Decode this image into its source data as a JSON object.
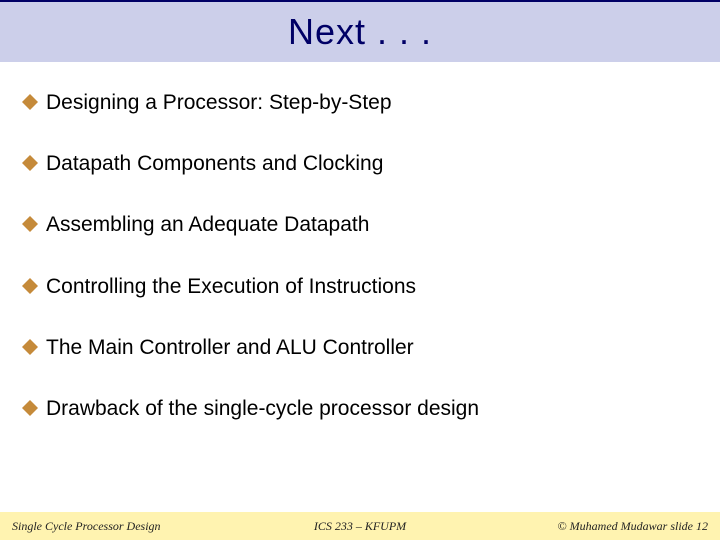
{
  "title": "Next . . .",
  "bullets": [
    "Designing a Processor: Step-by-Step",
    "Datapath Components and Clocking",
    "Assembling an Adequate Datapath",
    "Controlling the Execution of Instructions",
    "The Main Controller and ALU Controller",
    "Drawback of the single-cycle processor design"
  ],
  "footer": {
    "left": "Single Cycle Processor Design",
    "center": "ICS 233 – KFUPM",
    "right": "© Muhamed Mudawar  slide 12"
  }
}
